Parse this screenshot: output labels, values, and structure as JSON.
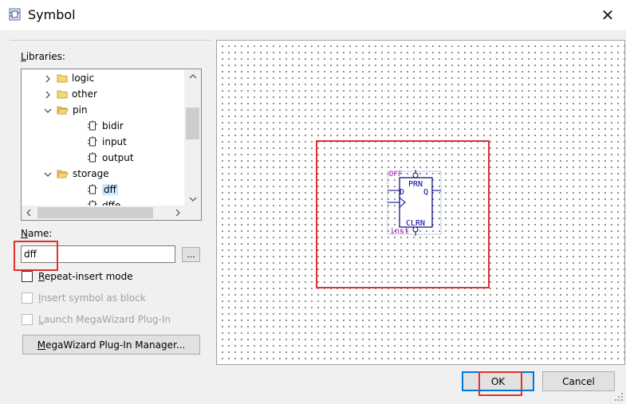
{
  "window": {
    "title": "Symbol",
    "close_glyph": "✕"
  },
  "libraries": {
    "label_underlined": "L",
    "label_rest": "ibraries:",
    "tree": [
      {
        "label": "logic",
        "level": 1,
        "expander": "collapsed",
        "icon": "folder-icon"
      },
      {
        "label": "other",
        "level": 1,
        "expander": "collapsed",
        "icon": "folder-icon"
      },
      {
        "label": "pin",
        "level": 1,
        "expander": "expanded",
        "icon": "folder-open-icon"
      },
      {
        "label": "bidir",
        "level": 2,
        "expander": "none",
        "icon": "symbol-icon"
      },
      {
        "label": "input",
        "level": 2,
        "expander": "none",
        "icon": "symbol-icon"
      },
      {
        "label": "output",
        "level": 2,
        "expander": "none",
        "icon": "symbol-icon"
      },
      {
        "label": "storage",
        "level": 1,
        "expander": "expanded",
        "icon": "folder-open-icon"
      },
      {
        "label": "dff",
        "level": 2,
        "expander": "none",
        "icon": "symbol-icon",
        "selected": true
      },
      {
        "label": "dffe",
        "level": 2,
        "expander": "none",
        "icon": "symbol-icon"
      }
    ]
  },
  "name": {
    "label_underlined": "N",
    "label_rest": "ame:",
    "value": "dff",
    "browse_label": "..."
  },
  "options": {
    "repeat_insert_u": "R",
    "repeat_insert_rest": "epeat-insert mode",
    "insert_block_u": "I",
    "insert_block_rest": "nsert symbol as block",
    "launch_mega_u": "L",
    "launch_mega_rest": "aunch MegaWizard Plug-In"
  },
  "megawizard": {
    "u": "M",
    "rest": "egaWizard Plug-In Manager..."
  },
  "symbol_preview": {
    "symbol_name": "DFF",
    "instance_name": "inst",
    "pins": {
      "d": "D",
      "q": "Q",
      "prn": "PRN",
      "clrn": "CLRN"
    }
  },
  "buttons": {
    "ok": "OK",
    "cancel": "Cancel"
  },
  "colors": {
    "selection": "#cce8ff",
    "focus_border": "#0078d7",
    "annotation": "#e03030",
    "symbol_text_blue": "#0000a0",
    "symbol_text_purple": "#a020a0"
  }
}
